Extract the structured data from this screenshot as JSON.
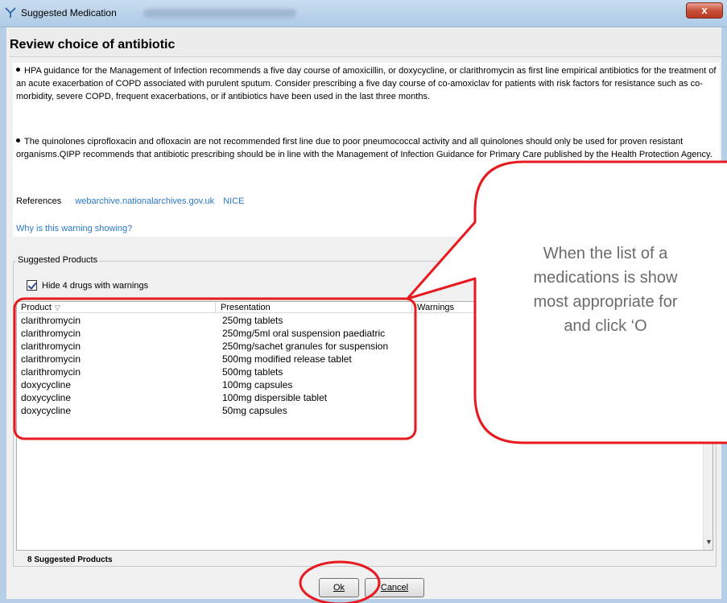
{
  "window": {
    "title": "Suggested Medication",
    "close_glyph": "x"
  },
  "page": {
    "title": "Review choice of antibiotic"
  },
  "guidance": {
    "para1": "HPA guidance for the Management of Infection recommends a five day course of amoxicillin, or doxycycline, or clarithromycin as first line empirical antibiotics for the treatment of an acute exacerbation of COPD associated with purulent sputum. Consider prescribing a five day course of co-amoxiclav for patients with risk factors for resistance such as co-morbidity, severe COPD, frequent exacerbations, or if antibiotics have been used in the last three months.",
    "para2": "The quinolones ciprofloxacin and ofloxacin are not recommended first line due to poor pneumococcal activity and all quinolones should only be used for proven resistant organisms.QIPP recommends that antibiotic prescribing should be in line with the Management of Infection Guidance for Primary Care published by the Health Protection Agency."
  },
  "references": {
    "label": "References",
    "link1": "webarchive.nationalarchives.gov.uk",
    "link2": "NICE",
    "why_link": "Why is this warning showing?"
  },
  "products": {
    "group_label": "Suggested Products",
    "hide_checkbox_label": "Hide 4 drugs with warnings",
    "hide_checked": true,
    "columns": [
      "Product",
      "Presentation",
      "Warnings"
    ],
    "rows": [
      {
        "product": "clarithromycin",
        "presentation": "250mg tablets"
      },
      {
        "product": "clarithromycin",
        "presentation": "250mg/5ml oral suspension paediatric"
      },
      {
        "product": "clarithromycin",
        "presentation": "250mg/sachet granules for suspension"
      },
      {
        "product": "clarithromycin",
        "presentation": "500mg modified release tablet"
      },
      {
        "product": "clarithromycin",
        "presentation": "500mg tablets"
      },
      {
        "product": "doxycycline",
        "presentation": "100mg capsules"
      },
      {
        "product": "doxycycline",
        "presentation": "100mg dispersible tablet"
      },
      {
        "product": "doxycycline",
        "presentation": "50mg capsules"
      }
    ],
    "count_text": "8 Suggested Products"
  },
  "buttons": {
    "ok": "Ok",
    "cancel": "Cancel"
  },
  "callout": {
    "line1": "When the list of a",
    "line2": "medications is show",
    "line3": "most appropriate for",
    "line4": "and click ‘O"
  },
  "colors": {
    "annotation_red": "#e8191e",
    "link_blue": "#2a78c6",
    "callout_text": "#6b6b6b"
  }
}
